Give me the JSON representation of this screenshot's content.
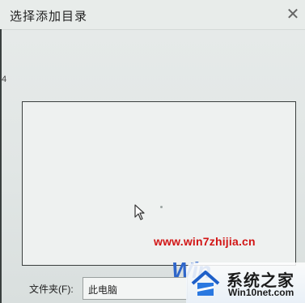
{
  "window": {
    "title": "选择添加目录",
    "close_label": "✕"
  },
  "left_edge_mark": "4",
  "folder": {
    "label": "文件夹(F):",
    "value": "此电脑"
  },
  "watermark": {
    "url": "www.win7zhijia.cn",
    "letters": "Win"
  },
  "site_logo": {
    "name": "系统之家",
    "domain": "Win10net.com"
  },
  "icons": {
    "cursor": "mouse-cursor-icon",
    "logo": "house-logo-icon"
  }
}
